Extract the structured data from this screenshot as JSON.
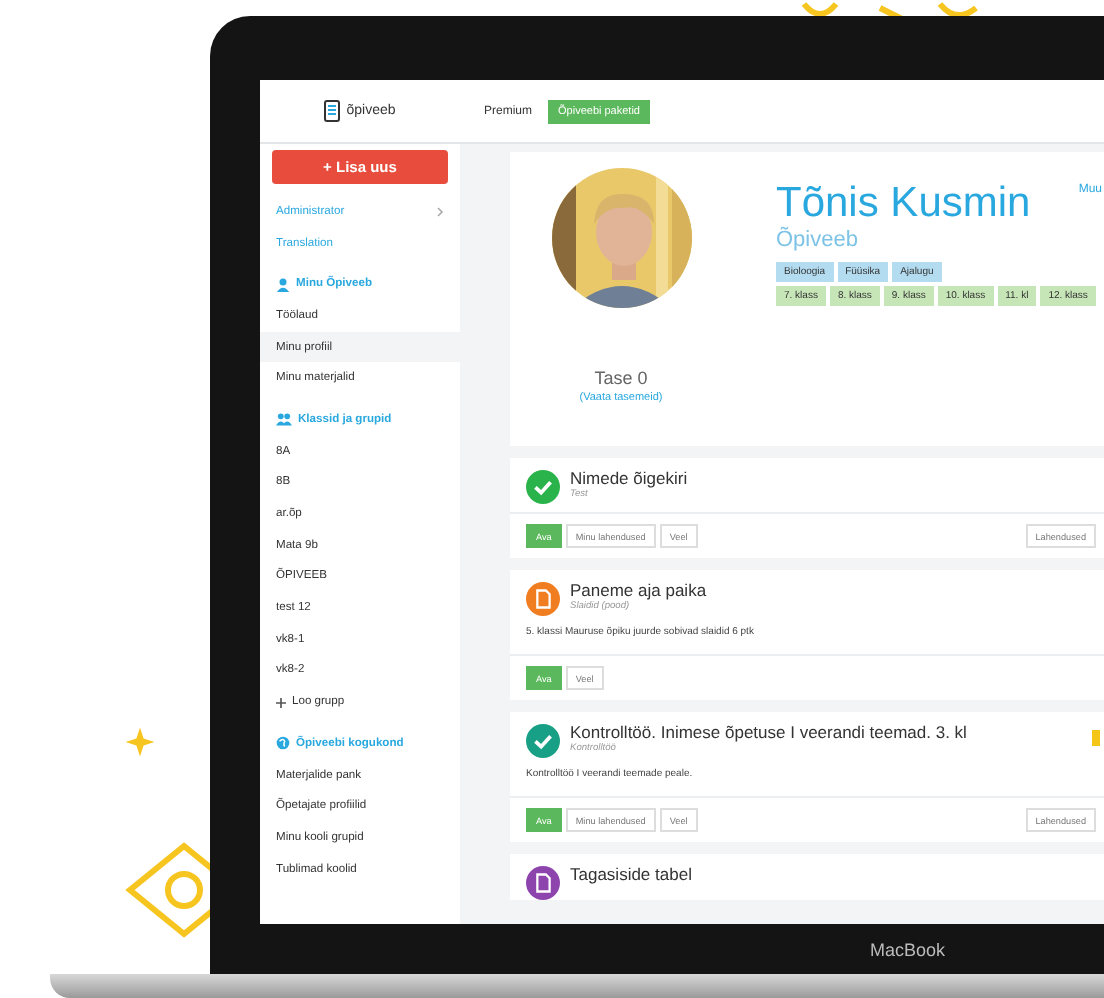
{
  "topbar": {
    "logo": "õpiveeb",
    "premium": "Premium",
    "packages_button": "Õpiveebi paketid"
  },
  "sidebar": {
    "add_button": "+ Lisa uus",
    "items": [
      {
        "kind": "link",
        "label": "Administrator",
        "submenu": true,
        "selected": false
      },
      {
        "kind": "link",
        "label": "Translation",
        "submenu": false,
        "selected": false
      },
      {
        "kind": "section",
        "label": "Minu Õpiveeb",
        "selected": false
      },
      {
        "kind": "item",
        "label": "Töölaud",
        "selected": false
      },
      {
        "kind": "item",
        "label": "Minu profiil",
        "selected": true
      },
      {
        "kind": "item",
        "label": "Minu materjalid",
        "selected": false
      },
      {
        "kind": "section",
        "label": "Klassid ja grupid",
        "selected": false
      },
      {
        "kind": "item",
        "label": "8A",
        "selected": false
      },
      {
        "kind": "item",
        "label": "8B",
        "selected": false
      },
      {
        "kind": "item",
        "label": "ar.õp",
        "selected": false
      },
      {
        "kind": "item",
        "label": "Mata 9b",
        "selected": false
      },
      {
        "kind": "item",
        "label": "ÕPIVEEB",
        "selected": false
      },
      {
        "kind": "item",
        "label": "test 12",
        "selected": false
      },
      {
        "kind": "item",
        "label": "vk8-1",
        "selected": false
      },
      {
        "kind": "item",
        "label": "vk8-2",
        "selected": false
      },
      {
        "kind": "add",
        "label": "Loo grupp",
        "selected": false
      },
      {
        "kind": "section",
        "label": "Õpiveebi kogukond",
        "selected": false
      },
      {
        "kind": "item",
        "label": "Materjalide pank",
        "selected": false
      },
      {
        "kind": "item",
        "label": "Õpetajate profiilid",
        "selected": false
      },
      {
        "kind": "item",
        "label": "Minu kooli grupid",
        "selected": false
      },
      {
        "kind": "item",
        "label": "Tublimad koolid",
        "selected": false
      }
    ]
  },
  "profile": {
    "photo": {
      "kind": "picture"
    },
    "name": "Tõnis Kusmin",
    "organization": "Õpiveeb",
    "edit_link": "Muu",
    "level": "Tase 0",
    "levels_link": "(Vaata tasemeid)",
    "subjects": [
      "Bioloogia",
      "Füüsika",
      "Ajalugu"
    ],
    "grades": [
      "7. klass",
      "8. klass",
      "9. klass",
      "10. klass",
      "11. kl",
      "12. klass"
    ]
  },
  "materials": [
    {
      "kind": "check",
      "color": "#2bb34b",
      "title": "Nimede õigekiri",
      "type": "Test",
      "buttons": [
        {
          "label": "Ava",
          "kind": "primary"
        },
        {
          "label": "Minu lahendused",
          "kind": "default"
        },
        {
          "label": "Veel",
          "kind": "default"
        }
      ],
      "right_button": "Lahendused",
      "ribbon": false
    },
    {
      "kind": "document",
      "color": "#f07d1f",
      "title": "Paneme aja paika",
      "type": "Slaidid (pood)",
      "description": "5. klassi Mauruse õpiku juurde sobivad slaidid 6 ptk",
      "buttons": [
        {
          "label": "Ava",
          "kind": "primary"
        },
        {
          "label": "Veel",
          "kind": "default"
        }
      ],
      "ribbon": false
    },
    {
      "kind": "check",
      "color": "#17a085",
      "title": "Kontrolltöö. Inimese õpetuse I veerandi teemad. 3. kl",
      "type": "Kontrolltöö",
      "description": "Kontrolltöö I veerandi teemade peale.",
      "buttons": [
        {
          "label": "Ava",
          "kind": "primary"
        },
        {
          "label": "Minu lahendused",
          "kind": "default"
        },
        {
          "label": "Veel",
          "kind": "default"
        }
      ],
      "right_button": "Lahendused",
      "ribbon": true
    },
    {
      "kind": "document",
      "color": "#8e44ad",
      "title": "Tagasiside tabel",
      "ribbon": false
    }
  ],
  "laptop": {
    "brand": "MacBook"
  }
}
